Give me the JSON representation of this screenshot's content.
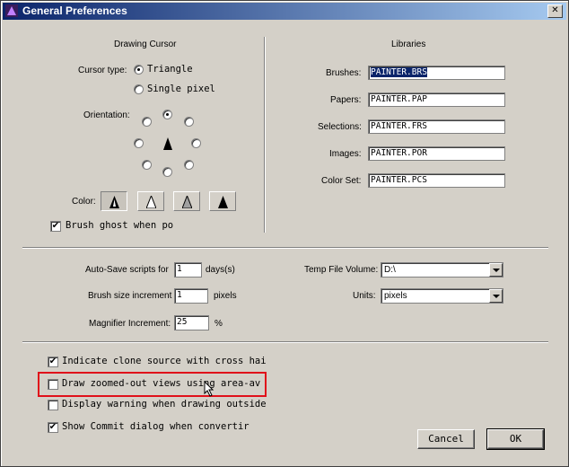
{
  "window": {
    "title": "General Preferences",
    "close_glyph": "✕"
  },
  "cursor": {
    "heading": "Drawing Cursor",
    "type_label": "Cursor type:",
    "options": [
      "Triangle",
      "Single pixel"
    ],
    "selected": "Triangle",
    "orientation_label": "Orientation:",
    "color_label": "Color:",
    "brush_ghost_label": "Brush ghost when po",
    "brush_ghost_checked": true
  },
  "libraries": {
    "heading": "Libraries",
    "items": [
      {
        "label": "Brushes:",
        "value": "PAINTER.BRS"
      },
      {
        "label": "Papers:",
        "value": "PAINTER.PAP"
      },
      {
        "label": "Selections:",
        "value": "PAINTER.FRS"
      },
      {
        "label": "Images:",
        "value": "PAINTER.POR"
      },
      {
        "label": "Color Set:",
        "value": "PAINTER.PCS"
      }
    ]
  },
  "settings": {
    "autosave_label": "Auto-Save scripts for",
    "autosave_value": "1",
    "autosave_unit": "days(s)",
    "brush_incr_label": "Brush size increment",
    "brush_incr_value": "1",
    "brush_incr_unit": "pixels",
    "magnifier_label": "Magnifier Increment:",
    "magnifier_value": "25",
    "magnifier_unit": "%",
    "temp_volume_label": "Temp File Volume:",
    "temp_volume_value": "D:\\",
    "units_label": "Units:",
    "units_value": "pixels"
  },
  "options": [
    {
      "label": "Indicate clone source with cross hai",
      "checked": true
    },
    {
      "label": "Draw zoomed-out views using area-av",
      "checked": false
    },
    {
      "label": "Display warning when drawing outside",
      "checked": false
    },
    {
      "label": "Show Commit dialog when convertir",
      "checked": true
    }
  ],
  "buttons": {
    "cancel": "Cancel",
    "ok": "OK"
  },
  "check_glyph": "✔"
}
